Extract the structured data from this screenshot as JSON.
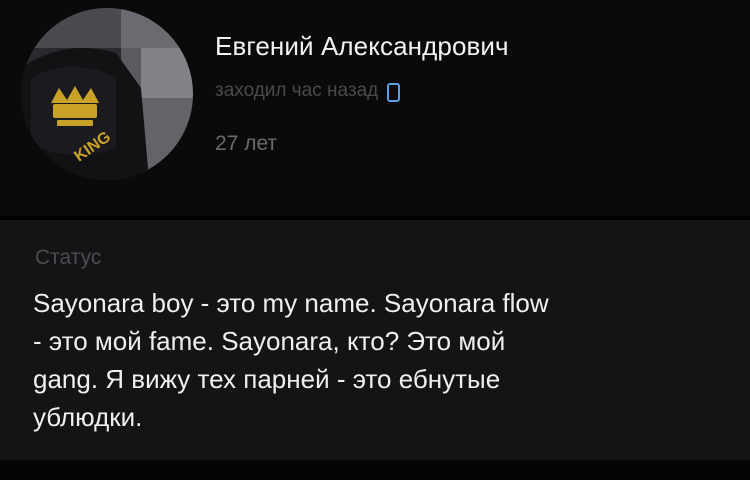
{
  "profile": {
    "name": "Евгений Александрович",
    "last_seen": "заходил час назад",
    "age": "27 лет",
    "avatar_text": "KING",
    "device_icon": "mobile-phone-icon"
  },
  "status": {
    "label": "Статус",
    "lines": [
      "Sayonara boy - это my name.  Sayonara flow",
      "- это мой fame.  Sayonara, кто? Это мой",
      "gang.  Я вижу тех парней - это ебнутые",
      "ублюдки."
    ]
  },
  "colors": {
    "background": "#000000",
    "header_bg": "#0a0a0b",
    "card_bg": "#141416",
    "device_icon": "#5aa0e6"
  }
}
